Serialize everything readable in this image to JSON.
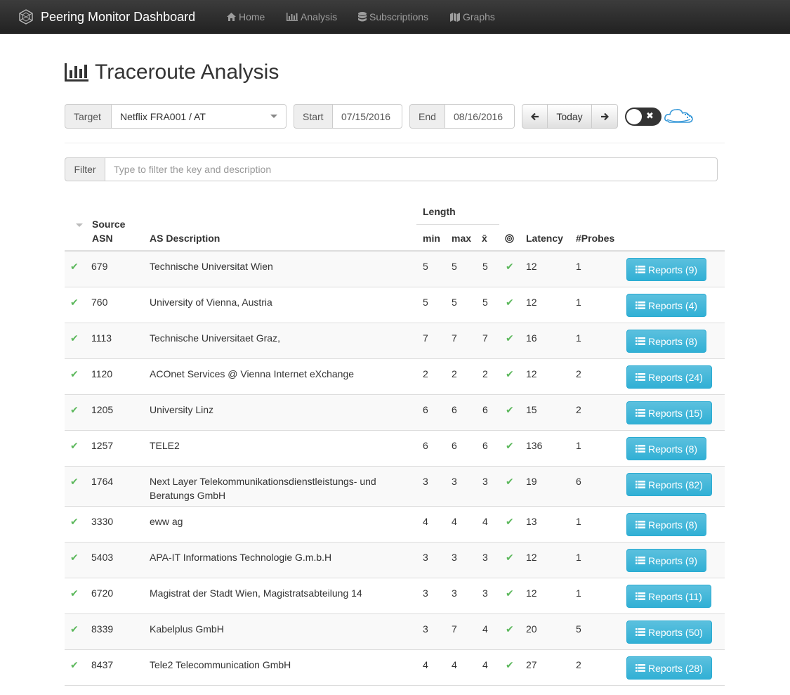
{
  "navbar": {
    "brand": "Peering Monitor Dashboard",
    "items": [
      {
        "label": "Home",
        "icon": "home-icon"
      },
      {
        "label": "Analysis",
        "icon": "bar-chart-icon"
      },
      {
        "label": "Subscriptions",
        "icon": "database-icon"
      },
      {
        "label": "Graphs",
        "icon": "map-icon"
      }
    ]
  },
  "page": {
    "title": "Traceroute Analysis"
  },
  "controls": {
    "target_label": "Target",
    "target_value": "Netflix FRA001 / AT",
    "start_label": "Start",
    "start_value": "07/15/2016",
    "end_label": "End",
    "end_value": "08/16/2016",
    "today_label": "Today"
  },
  "filter": {
    "label": "Filter",
    "placeholder": "Type to filter the key and description",
    "value": ""
  },
  "table": {
    "headers": {
      "source": "Source",
      "asn": "ASN",
      "description": "AS Description",
      "length": "Length",
      "min": "min",
      "max": "max",
      "mean": "x̄",
      "latency": "Latency",
      "probes": "#Probes"
    },
    "rows": [
      {
        "asn": "679",
        "desc": "Technische Universitat Wien",
        "min": "5",
        "max": "5",
        "mean": "5",
        "latency": "12",
        "probes": "1",
        "reports": "Reports (9)"
      },
      {
        "asn": "760",
        "desc": "University of Vienna, Austria",
        "min": "5",
        "max": "5",
        "mean": "5",
        "latency": "12",
        "probes": "1",
        "reports": "Reports (4)"
      },
      {
        "asn": "1113",
        "desc": "Technische Universitaet Graz,",
        "min": "7",
        "max": "7",
        "mean": "7",
        "latency": "16",
        "probes": "1",
        "reports": "Reports (8)"
      },
      {
        "asn": "1120",
        "desc": "ACOnet Services @ Vienna Internet eXchange",
        "min": "2",
        "max": "2",
        "mean": "2",
        "latency": "12",
        "probes": "2",
        "reports": "Reports (24)"
      },
      {
        "asn": "1205",
        "desc": "University Linz",
        "min": "6",
        "max": "6",
        "mean": "6",
        "latency": "15",
        "probes": "2",
        "reports": "Reports (15)"
      },
      {
        "asn": "1257",
        "desc": "TELE2",
        "min": "6",
        "max": "6",
        "mean": "6",
        "latency": "136",
        "probes": "1",
        "reports": "Reports (8)"
      },
      {
        "asn": "1764",
        "desc": "Next Layer Telekommunikationsdienstleistungs- und",
        "desc2": "Beratungs GmbH",
        "min": "3",
        "max": "3",
        "mean": "3",
        "latency": "19",
        "probes": "6",
        "reports": "Reports (82)"
      },
      {
        "asn": "3330",
        "desc": "eww ag",
        "min": "4",
        "max": "4",
        "mean": "4",
        "latency": "13",
        "probes": "1",
        "reports": "Reports (8)"
      },
      {
        "asn": "5403",
        "desc": "APA-IT Informations Technologie G.m.b.H",
        "min": "3",
        "max": "3",
        "mean": "3",
        "latency": "12",
        "probes": "1",
        "reports": "Reports (9)"
      },
      {
        "asn": "6720",
        "desc": "Magistrat der Stadt Wien, Magistratsabteilung 14",
        "min": "3",
        "max": "3",
        "mean": "3",
        "latency": "12",
        "probes": "1",
        "reports": "Reports (11)"
      },
      {
        "asn": "8339",
        "desc": "Kabelplus GmbH",
        "min": "3",
        "max": "7",
        "mean": "4",
        "latency": "20",
        "probes": "5",
        "reports": "Reports (50)"
      },
      {
        "asn": "8437",
        "desc": "Tele2 Telecommunication GmbH",
        "min": "4",
        "max": "4",
        "mean": "4",
        "latency": "27",
        "probes": "2",
        "reports": "Reports (28)"
      }
    ]
  },
  "colors": {
    "navbar": "#222222",
    "info_button": "#31b0d5",
    "success_check": "#5cb85c"
  }
}
